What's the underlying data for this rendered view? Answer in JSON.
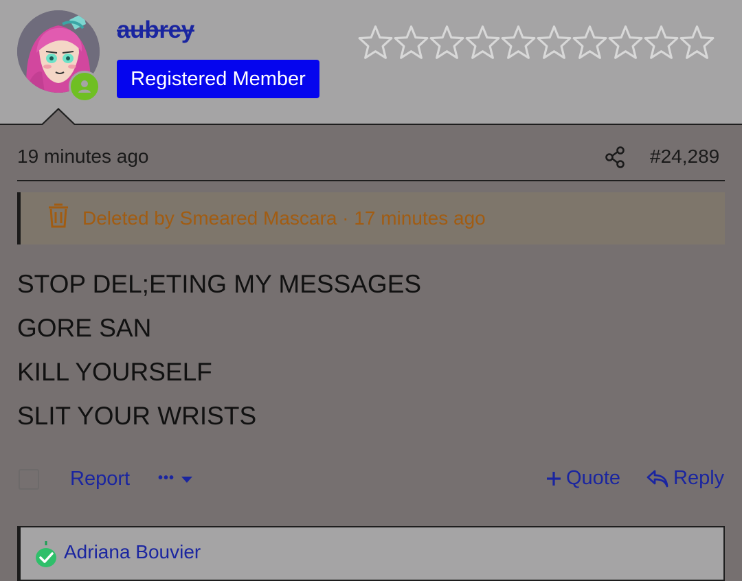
{
  "author": {
    "username": "aubrey",
    "role": "Registered Member",
    "rating_stars_filled": 0,
    "rating_stars_total": 10,
    "online": true
  },
  "post": {
    "time": "19 minutes ago",
    "number": "#24,289",
    "deleted_notice": "Deleted by Smeared Mascara · 17 minutes ago",
    "lines": [
      "STOP DEL;ETING MY MESSAGES",
      "GORE SAN",
      "KILL YOURSELF",
      "SLIT YOUR WRISTS"
    ]
  },
  "actions": {
    "report": "Report",
    "more": "•••",
    "quote": "Quote",
    "reply": "Reply"
  },
  "next_post": {
    "username": "Adriana Bouvier"
  },
  "colors": {
    "header_bg": "#a5a4a5",
    "body_bg": "#767070",
    "link": "#1a25a0",
    "badge": "#0505ee",
    "deleted_text": "#a15c12",
    "online": "#6fbf23"
  }
}
